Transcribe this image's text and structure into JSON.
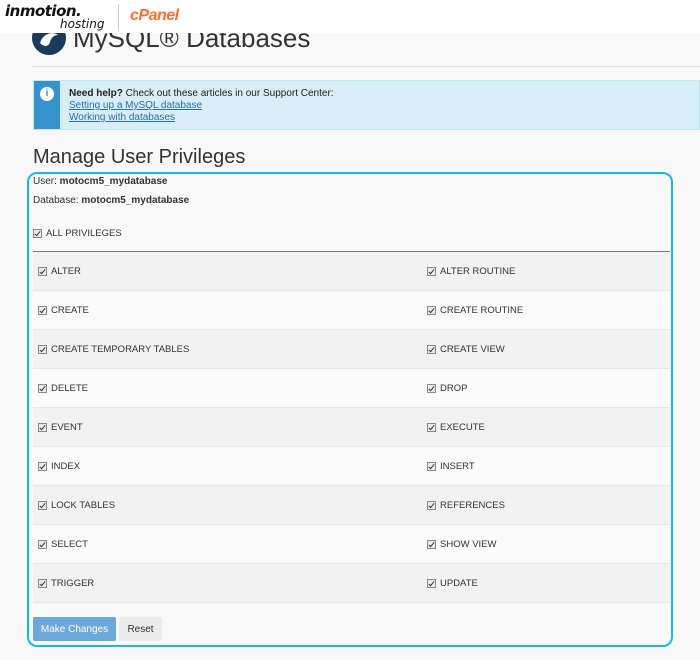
{
  "brand": {
    "inmotion_line1": "inmotion.",
    "inmotion_line2": "hosting",
    "cpanel": "cPanel",
    "logo_icon": "database-logo-icon"
  },
  "page": {
    "title": "MySQL® Databases"
  },
  "help": {
    "icon": "info-icon",
    "lead_bold": "Need help?",
    "lead_text": " Check out these articles in our Support Center:",
    "links": [
      "Setting up a MySQL database",
      "Working with databases"
    ]
  },
  "section": {
    "title": "Manage User Privileges"
  },
  "meta": {
    "user_label": "User: ",
    "user_value": "motocm5_mydatabase",
    "db_label": "Database: ",
    "db_value": "motocm5_mydatabase"
  },
  "all_privileges": {
    "label": "ALL PRIVILEGES",
    "checked": true
  },
  "privileges": [
    {
      "left": "ALTER",
      "right": "ALTER ROUTINE"
    },
    {
      "left": "CREATE",
      "right": "CREATE ROUTINE"
    },
    {
      "left": "CREATE TEMPORARY TABLES",
      "right": "CREATE VIEW"
    },
    {
      "left": "DELETE",
      "right": "DROP"
    },
    {
      "left": "EVENT",
      "right": "EXECUTE"
    },
    {
      "left": "INDEX",
      "right": "INSERT"
    },
    {
      "left": "LOCK TABLES",
      "right": "REFERENCES"
    },
    {
      "left": "SELECT",
      "right": "SHOW VIEW"
    },
    {
      "left": "TRIGGER",
      "right": "UPDATE"
    }
  ],
  "buttons": {
    "make_changes": "Make Changes",
    "reset": "Reset"
  },
  "colors": {
    "highlight": "#1ab8e8",
    "primary_button": "#6da8db",
    "cpanel_orange": "#ff6c2c",
    "help_bg": "#d9edf7",
    "help_icon_bg": "#3793cd"
  }
}
